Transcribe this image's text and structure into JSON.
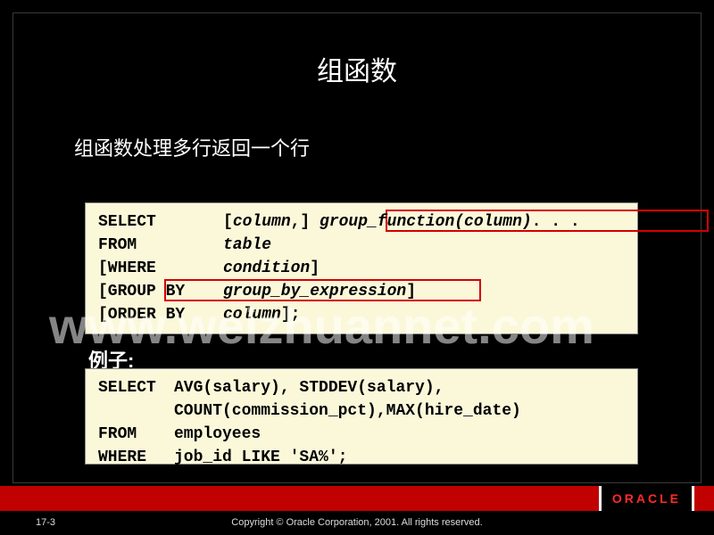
{
  "title": "组函数",
  "subtitle": "组函数处理多行返回一个行",
  "syntax": {
    "r1_kw": "SELECT",
    "r1_p1": "[",
    "r1_p2": "column",
    "r1_p3": ",] ",
    "r1_p4": "group_function(column)",
    "r1_p5": ". . .",
    "r2_kw": "FROM",
    "r2_it": "table",
    "r3_kw": "[WHERE",
    "r3_it": "condition",
    "r3_end": "]",
    "r4_kw": "[GROUP BY",
    "r4_it": "group_by_expression",
    "r4_end": "]",
    "r5_kw": "[ORDER BY",
    "r5_it": "column",
    "r5_end": "];"
  },
  "example_label": "例子:",
  "example": {
    "l1_a": "SELECT ",
    "l1_b": "AVG(salary), STDDEV(salary),",
    "l2": "COUNT(commission_pct),MAX(hire_date)",
    "l3_a": "FROM   ",
    "l3_b": "employees",
    "l4_a": "WHERE  ",
    "l4_b": "job_id LIKE 'SA%';"
  },
  "watermark": "www.weizhuannet.com",
  "oracle": "ORACLE",
  "pagenum": "17-3",
  "copyright": "Copyright © Oracle Corporation,  2001. All rights reserved."
}
